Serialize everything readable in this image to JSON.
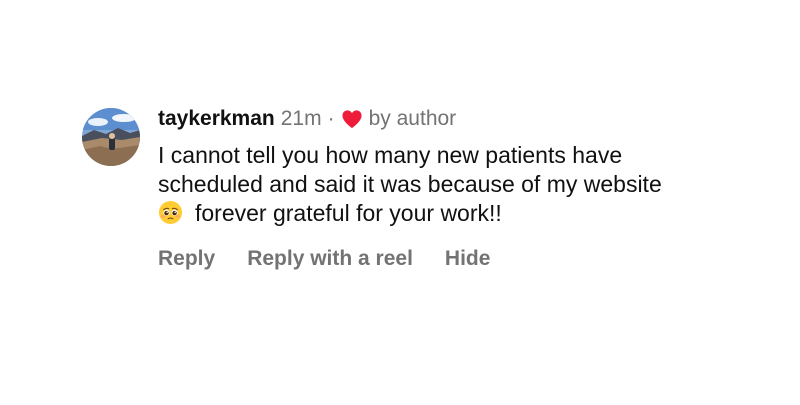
{
  "comment": {
    "avatar_icon": "profile-photo-mountain-avatar",
    "username": "taykerkman",
    "time": "21m",
    "separator": "·",
    "liked_icon": "heart-icon",
    "liked_label": "by author",
    "text_lines": [
      "I cannot tell you how many new patients have",
      "scheduled and said it was because of my website",
      "forever grateful for your work!!"
    ],
    "emoji_icon": "pleading-face-emoji",
    "actions": {
      "reply": "Reply",
      "reply_reel": "Reply with a reel",
      "hide": "Hide"
    }
  },
  "colors": {
    "heart": "#ed1c3a",
    "muted": "#737373",
    "text": "#111111",
    "background": "#ffffff"
  }
}
